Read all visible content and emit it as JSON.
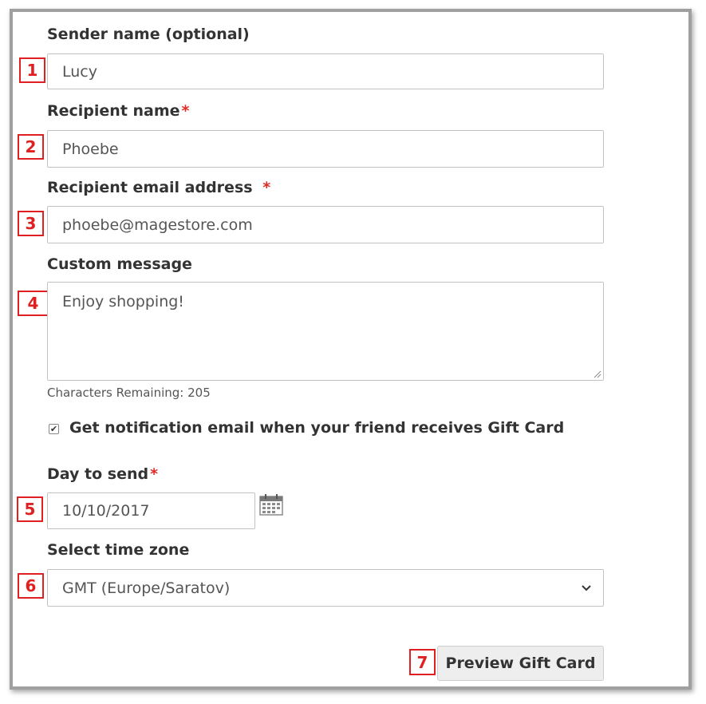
{
  "form": {
    "sender": {
      "label": "Sender name (optional)",
      "value": "Lucy",
      "badge": "1"
    },
    "recipient": {
      "label": "Recipient name",
      "required_mark": "*",
      "value": "Phoebe",
      "badge": "2"
    },
    "email": {
      "label": "Recipient email address",
      "required_mark": "*",
      "value": "phoebe@magestore.com",
      "badge": "3"
    },
    "message": {
      "label": "Custom message",
      "value": "Enjoy shopping!",
      "badge": "4",
      "chars_remaining": "Characters Remaining: 205"
    },
    "notify": {
      "label": "Get notification email when your friend receives Gift Card",
      "checked": true,
      "check_glyph": "✔"
    },
    "day": {
      "label": "Day to send",
      "required_mark": "*",
      "value": "10/10/2017",
      "badge": "5",
      "icon": "calendar-icon"
    },
    "timezone": {
      "label": "Select time zone",
      "value": "GMT (Europe/Saratov)",
      "badge": "6",
      "icon": "chevron-down-icon"
    },
    "preview": {
      "label": "Preview Gift Card",
      "badge": "7"
    }
  },
  "colors": {
    "badge_red": "#e02020",
    "required_red": "#e02b27",
    "frame_gray": "#a0a0a0"
  }
}
